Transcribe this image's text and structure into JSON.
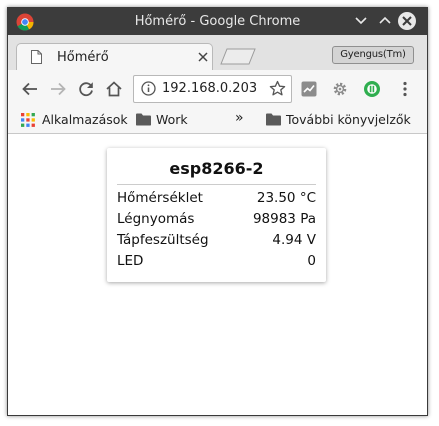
{
  "window": {
    "title": "Hőmérő - Google Chrome",
    "controls": {
      "minimize_icon": "chevron-down-icon",
      "maximize_icon": "chevron-up-icon",
      "close_icon": "close-icon"
    }
  },
  "tab": {
    "title": "Hőmérő",
    "icon": "page-icon",
    "close_icon": "close-icon"
  },
  "profile": {
    "name": "Gyengus(Tm)"
  },
  "toolbar": {
    "back_icon": "back-arrow-icon",
    "forward_icon": "forward-arrow-icon",
    "reload_icon": "reload-icon",
    "home_icon": "home-icon",
    "url": "192.168.0.203",
    "info_icon": "info-icon",
    "star_icon": "star-icon",
    "extensions": [
      "chart-extension-icon",
      "gear-extension-icon",
      "circle-extension-icon"
    ],
    "menu_icon": "kebab-menu-icon"
  },
  "bookmarks": {
    "apps_label": "Alkalmazások",
    "work_label": "Work",
    "overflow": "»",
    "other_label": "További könyvjelzők"
  },
  "card": {
    "title": "esp8266-2",
    "rows": [
      {
        "label": "Hőmérséklet",
        "value": "23.50 °C"
      },
      {
        "label": "Légnyomás",
        "value": "98983 Pa"
      },
      {
        "label": "Tápfeszültség",
        "value": "4.94 V"
      },
      {
        "label": "LED",
        "value": "0"
      }
    ]
  },
  "colors": {
    "titlebar": "#3c3c3c",
    "tabstrip": "#e2e2e2",
    "toolbar": "#f6f6f6",
    "extension_green": "#2fae4f",
    "extension_gray": "#8c8c8c"
  }
}
